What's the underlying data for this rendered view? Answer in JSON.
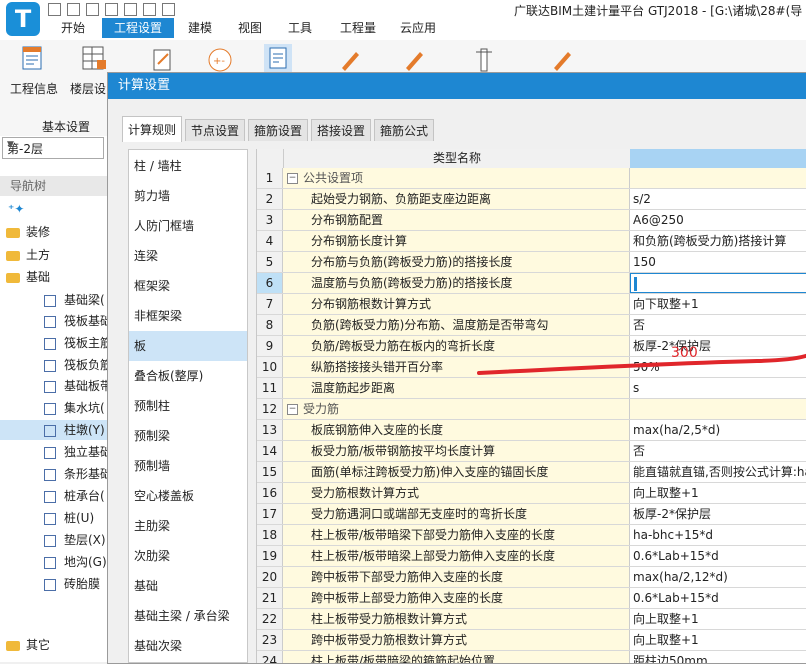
{
  "app": {
    "logo_letter": "T",
    "title": "广联达BIM土建计量平台 GTJ2018 - [G:\\诸城\\28#(导"
  },
  "menu": {
    "items": [
      {
        "label": "开始",
        "active": false
      },
      {
        "label": "工程设置",
        "active": true
      },
      {
        "label": "建模",
        "active": false
      },
      {
        "label": "视图",
        "active": false
      },
      {
        "label": "工具",
        "active": false
      },
      {
        "label": "工程量",
        "active": false
      },
      {
        "label": "云应用",
        "active": false
      }
    ]
  },
  "ribbon": {
    "project_info": "工程信息",
    "floor_settings": "楼层设",
    "group_label": "基本设置"
  },
  "nav": {
    "floor_value": "第-2层",
    "title": "导航树",
    "tree": [
      {
        "label": "装修",
        "type": "folder",
        "icon": "folder-icon"
      },
      {
        "label": "土方",
        "type": "folder",
        "icon": "folder-icon"
      },
      {
        "label": "基础",
        "type": "folder",
        "icon": "folder-icon"
      },
      {
        "label": "基础梁(",
        "type": "item",
        "icon": "beam-icon"
      },
      {
        "label": "筏板基础",
        "type": "item",
        "icon": "raft-icon"
      },
      {
        "label": "筏板主筋",
        "type": "item",
        "icon": "grid-icon"
      },
      {
        "label": "筏板负筋",
        "type": "item",
        "icon": "negative-bar-icon"
      },
      {
        "label": "基础板带",
        "type": "item",
        "icon": "band-icon"
      },
      {
        "label": "集水坑(",
        "type": "item",
        "icon": "sump-icon"
      },
      {
        "label": "柱墩(Y)",
        "type": "item",
        "icon": "column-pier-icon",
        "selected": true
      },
      {
        "label": "独立基础",
        "type": "item",
        "icon": "isolated-footing-icon"
      },
      {
        "label": "条形基础",
        "type": "item",
        "icon": "strip-footing-icon"
      },
      {
        "label": "桩承台(",
        "type": "item",
        "icon": "pile-cap-icon"
      },
      {
        "label": "桩(U)",
        "type": "item",
        "icon": "pile-icon"
      },
      {
        "label": "垫层(X)",
        "type": "item",
        "icon": "cushion-icon"
      },
      {
        "label": "地沟(G)",
        "type": "item",
        "icon": "trench-icon"
      },
      {
        "label": "砖胎膜",
        "type": "item",
        "icon": "brick-mold-icon"
      },
      {
        "label": "其它",
        "type": "folder",
        "icon": "folder-icon"
      }
    ]
  },
  "dialog": {
    "title": "计算设置",
    "tabs": [
      {
        "label": "计算规则",
        "active": true
      },
      {
        "label": "节点设置",
        "active": false
      },
      {
        "label": "箍筋设置",
        "active": false
      },
      {
        "label": "搭接设置",
        "active": false
      },
      {
        "label": "箍筋公式",
        "active": false
      }
    ],
    "categories": [
      {
        "label": "柱 / 墙柱"
      },
      {
        "label": "剪力墙"
      },
      {
        "label": "人防门框墙"
      },
      {
        "label": "连梁"
      },
      {
        "label": "框架梁"
      },
      {
        "label": "非框架梁"
      },
      {
        "label": "板",
        "active": true
      },
      {
        "label": "叠合板(整厚)"
      },
      {
        "label": "预制柱"
      },
      {
        "label": "预制梁"
      },
      {
        "label": "预制墙"
      },
      {
        "label": "空心楼盖板"
      },
      {
        "label": "主肋梁"
      },
      {
        "label": "次肋梁"
      },
      {
        "label": "基础"
      },
      {
        "label": "基础主梁 / 承台梁"
      },
      {
        "label": "基础次梁"
      }
    ],
    "grid": {
      "header_name": "类型名称",
      "rows": [
        {
          "num": "1",
          "name": "公共设置项",
          "value": "",
          "group": true
        },
        {
          "num": "2",
          "name": "起始受力钢筋、负筋距支座边距离",
          "value": "s/2"
        },
        {
          "num": "3",
          "name": "分布钢筋配置",
          "value": "A6@250"
        },
        {
          "num": "4",
          "name": "分布钢筋长度计算",
          "value": "和负筋(跨板受力筋)搭接计算"
        },
        {
          "num": "5",
          "name": "分布筋与负筋(跨板受力筋)的搭接长度",
          "value": "150"
        },
        {
          "num": "6",
          "name": "温度筋与负筋(跨板受力筋)的搭接长度",
          "value": "",
          "selected": true
        },
        {
          "num": "7",
          "name": "分布钢筋根数计算方式",
          "value": "向下取整+1"
        },
        {
          "num": "8",
          "name": "负筋(跨板受力筋)分布筋、温度筋是否带弯勾",
          "value": "否"
        },
        {
          "num": "9",
          "name": "负筋/跨板受力筋在板内的弯折长度",
          "value": "板厚-2*保护层"
        },
        {
          "num": "10",
          "name": "纵筋搭接接头错开百分率",
          "value": "50%"
        },
        {
          "num": "11",
          "name": "温度筋起步距离",
          "value": "s"
        },
        {
          "num": "12",
          "name": "受力筋",
          "value": "",
          "group": true
        },
        {
          "num": "13",
          "name": "板底钢筋伸入支座的长度",
          "value": "max(ha/2,5*d)"
        },
        {
          "num": "14",
          "name": "板受力筋/板带钢筋按平均长度计算",
          "value": "否"
        },
        {
          "num": "15",
          "name": "面筋(单标注跨板受力筋)伸入支座的锚固长度",
          "value": "能直锚就直锚,否则按公式计算:ha"
        },
        {
          "num": "16",
          "name": "受力筋根数计算方式",
          "value": "向上取整+1"
        },
        {
          "num": "17",
          "name": "受力筋遇洞口或端部无支座时的弯折长度",
          "value": "板厚-2*保护层"
        },
        {
          "num": "18",
          "name": "柱上板带/板带暗梁下部受力筋伸入支座的长度",
          "value": "ha-bhc+15*d"
        },
        {
          "num": "19",
          "name": "柱上板带/板带暗梁上部受力筋伸入支座的长度",
          "value": "0.6*Lab+15*d"
        },
        {
          "num": "20",
          "name": "跨中板带下部受力筋伸入支座的长度",
          "value": "max(ha/2,12*d)"
        },
        {
          "num": "21",
          "name": "跨中板带上部受力筋伸入支座的长度",
          "value": "0.6*Lab+15*d"
        },
        {
          "num": "22",
          "name": "柱上板带受力筋根数计算方式",
          "value": "向上取整+1"
        },
        {
          "num": "23",
          "name": "跨中板带受力筋根数计算方式",
          "value": "向上取整+1"
        },
        {
          "num": "24",
          "name": "柱上板带/板带暗梁的箍筋起始位置",
          "value": "距柱边50mm"
        }
      ]
    },
    "annotation": {
      "text": "300",
      "color": "#e0262b"
    }
  },
  "colors": {
    "accent": "#1e87d2",
    "row_name_bg": "#fffadf",
    "selected_bg": "#cde4f7",
    "annotation": "#e0262b"
  }
}
